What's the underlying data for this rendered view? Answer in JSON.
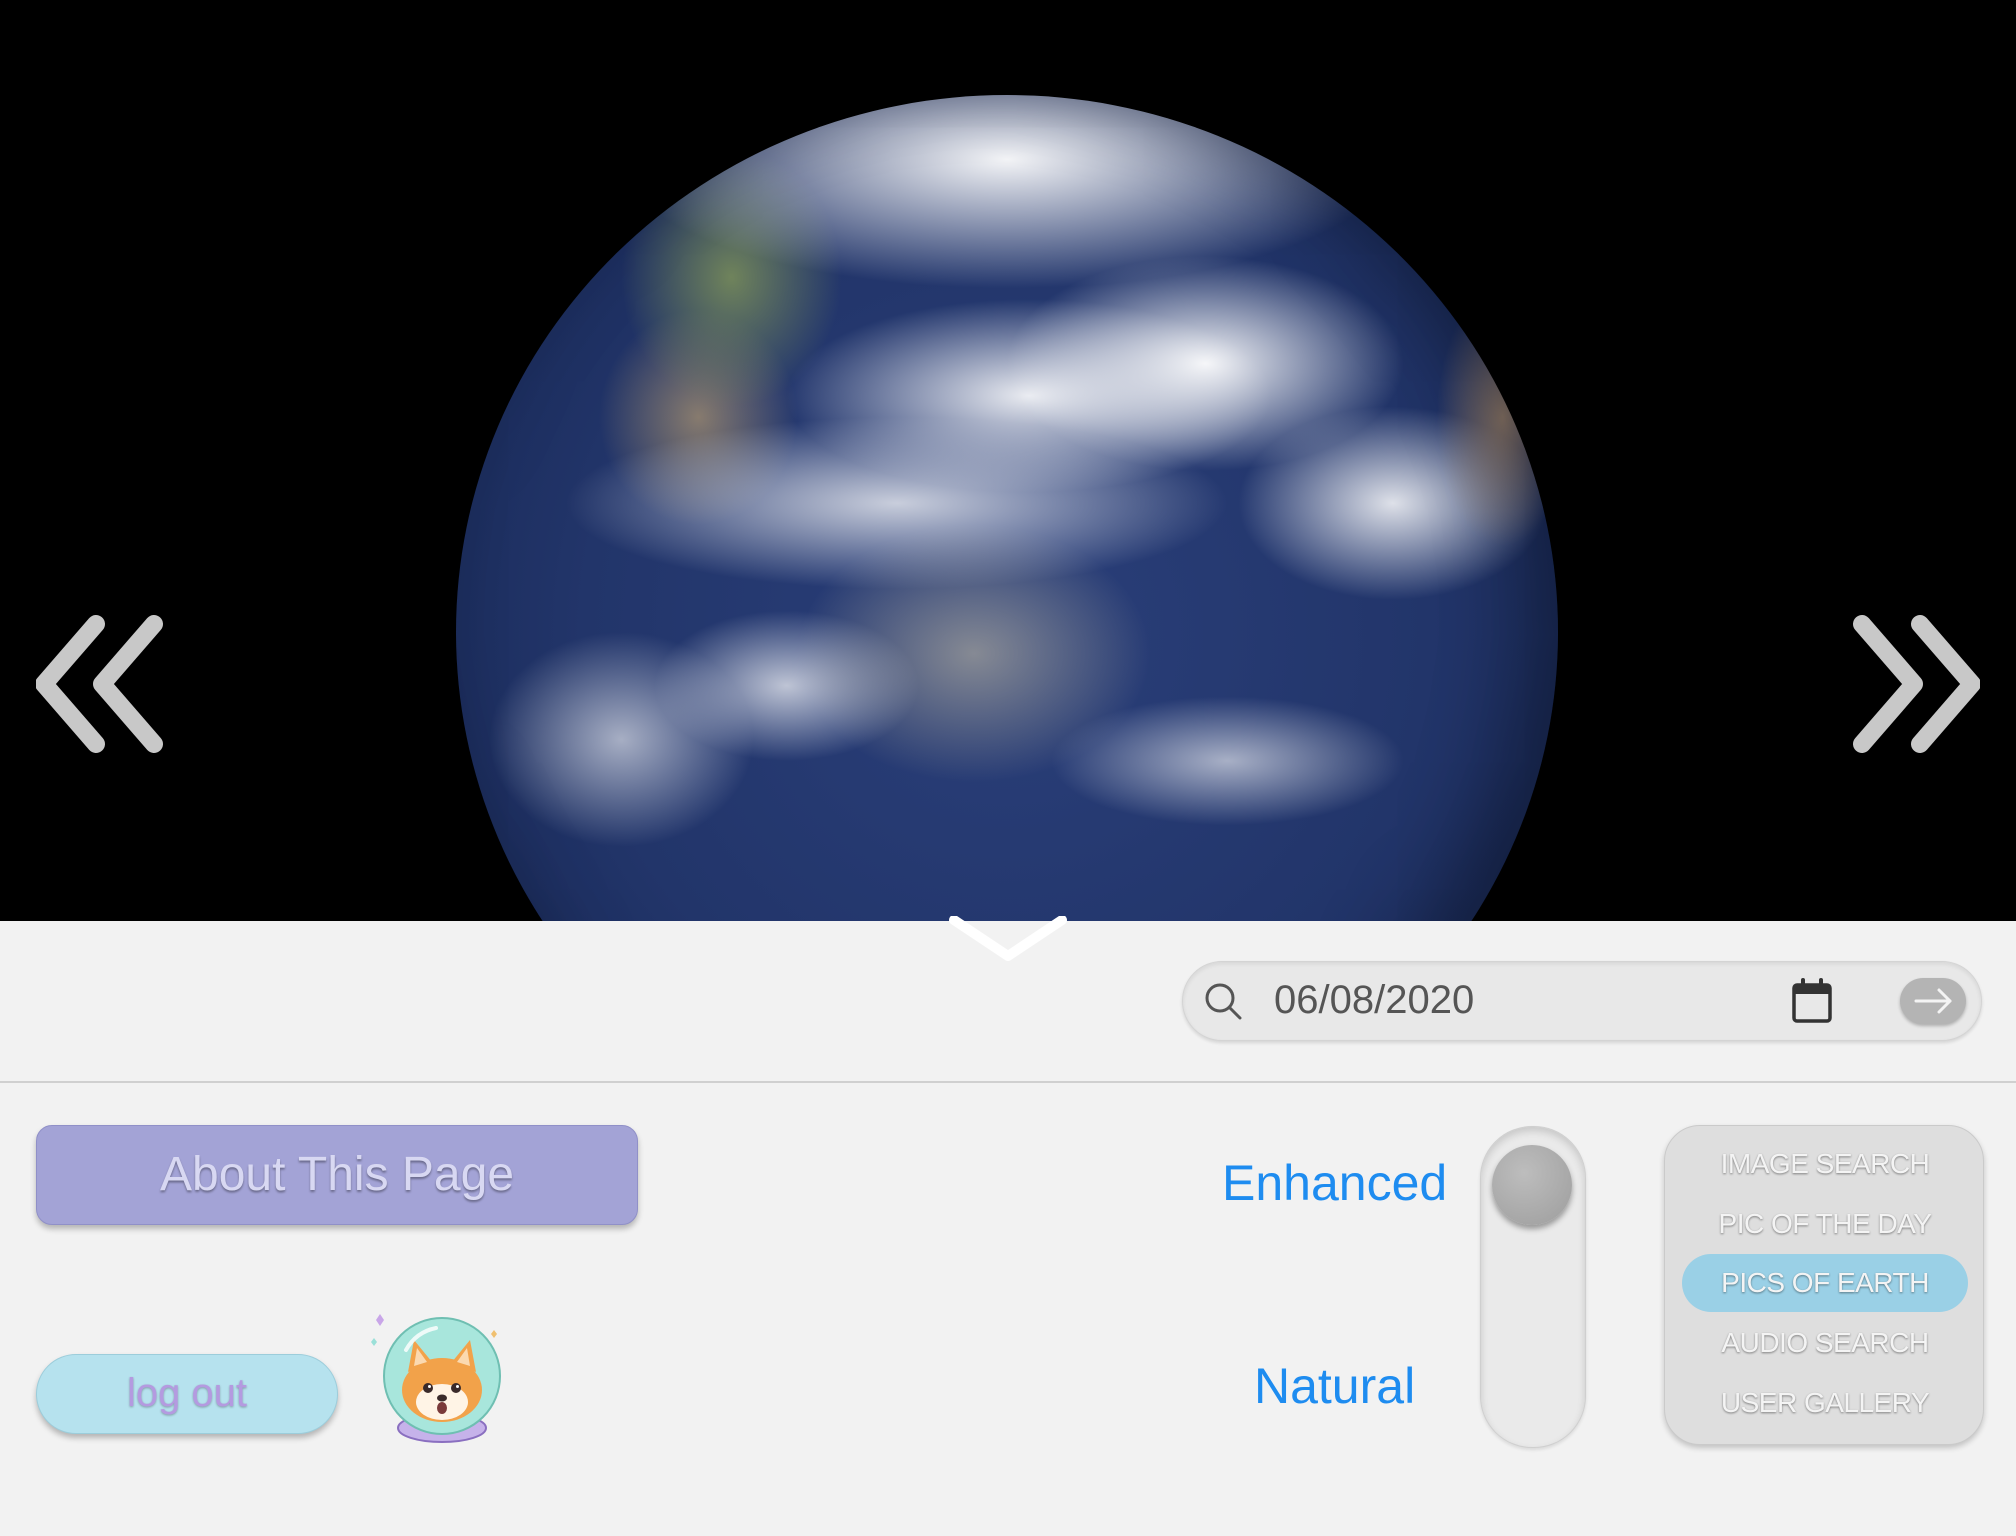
{
  "search": {
    "value": "06/08/2020"
  },
  "about": {
    "label": "About This Page"
  },
  "auth": {
    "logout_label": "log out"
  },
  "toggle": {
    "enhanced_label": "Enhanced",
    "natural_label": "Natural",
    "selected": "Enhanced"
  },
  "menu": {
    "items": [
      {
        "label": "IMAGE SEARCH",
        "active": false
      },
      {
        "label": "PIC OF THE DAY",
        "active": false
      },
      {
        "label": "PICS OF EARTH",
        "active": true
      },
      {
        "label": "AUDIO SEARCH",
        "active": false
      },
      {
        "label": "USER GALLERY",
        "active": false
      }
    ]
  },
  "icons": {
    "prev": "double-chevron-left-icon",
    "next": "double-chevron-right-icon",
    "collapse": "chevron-down-icon",
    "search": "search-icon",
    "calendar": "calendar-icon",
    "go": "arrow-right-icon",
    "avatar": "shiba-astronaut-avatar"
  },
  "colors": {
    "about_button": "#a3a3d6",
    "logout_button": "#b6e2ee",
    "toggle_label": "#1e8cf0",
    "active_menu": "#9ad0e6"
  }
}
